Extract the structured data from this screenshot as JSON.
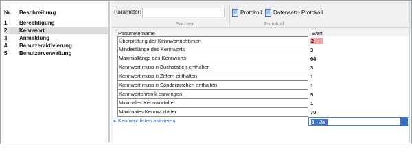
{
  "nav": {
    "header_nr": "Nr.",
    "header_desc": "Beschreibung",
    "items": [
      {
        "nr": "1",
        "label": "Berechtigung"
      },
      {
        "nr": "2",
        "label": "Kennwort"
      },
      {
        "nr": "3",
        "label": "Anmeldung"
      },
      {
        "nr": "4",
        "label": "Benutzeraktivierung"
      },
      {
        "nr": "5",
        "label": "Benutzerverwaltung"
      }
    ]
  },
  "toolbar": {
    "param_label": "Parameter:",
    "param_value": "",
    "search_caption": "Suchen",
    "protocol_button": "Protokoll",
    "record_protocol_button": "Datensatz- Protokoll",
    "protocol_caption": "Protokoll"
  },
  "grid": {
    "col_name": "Parametername",
    "col_value": "Wert",
    "rows": [
      {
        "name": "Überprüfung der Kennwortrichtlinien",
        "value": "2"
      },
      {
        "name": "Mindestlänge des Kennworts",
        "value": "3"
      },
      {
        "name": "Maximallänge des Kennworts",
        "value": "64"
      },
      {
        "name": "Kennwort muss n Buchstaben enthalten",
        "value": "3"
      },
      {
        "name": "Kennwort muss n Ziffern enthalten",
        "value": "1"
      },
      {
        "name": "Kennwort muss n Sonderzeichen enthalten",
        "value": "1"
      },
      {
        "name": "Kennwortchronik erzwingen",
        "value": "5"
      },
      {
        "name": "Minimales Kennwortalter",
        "value": "1"
      },
      {
        "name": "Maximales Kennwortalter",
        "value": "70"
      },
      {
        "name": "Kennwortlisten aktivieren",
        "value": "1 - Ja"
      }
    ]
  },
  "colors": {
    "accent": "#3a6fc8",
    "changed_value": "#f0a5a5",
    "selected_nav": "#dcdcdc"
  }
}
